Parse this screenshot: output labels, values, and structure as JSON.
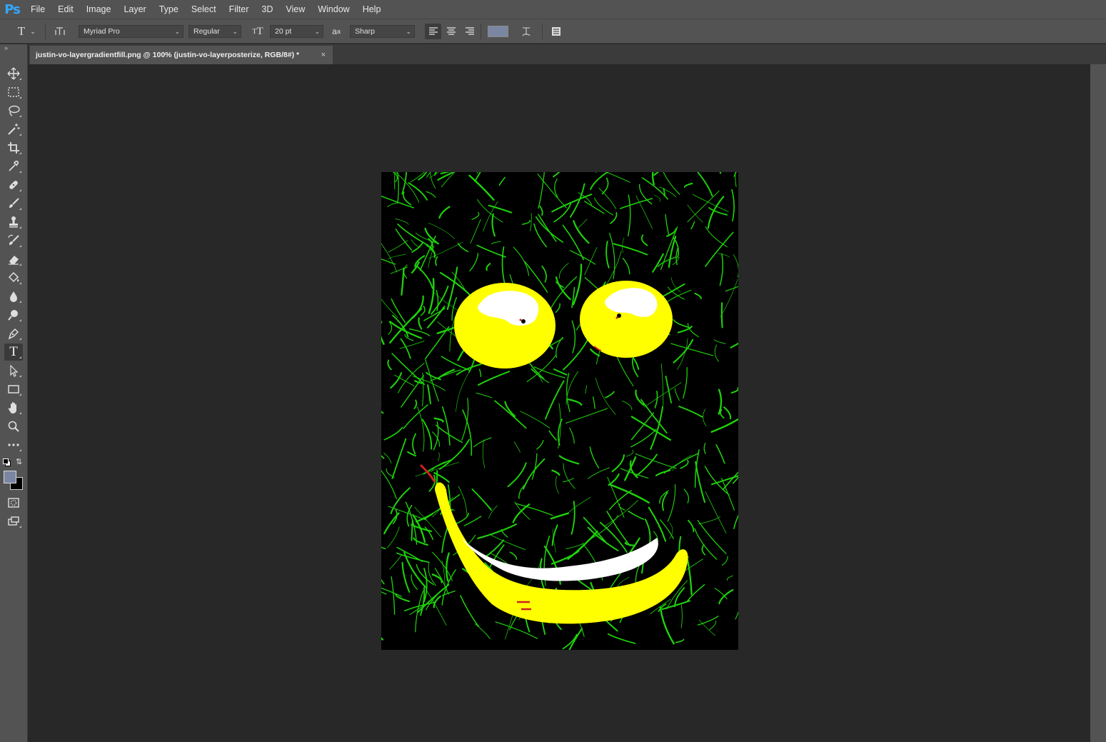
{
  "app": {
    "logo": "Ps"
  },
  "menu": [
    "File",
    "Edit",
    "Image",
    "Layer",
    "Type",
    "Select",
    "Filter",
    "3D",
    "View",
    "Window",
    "Help"
  ],
  "options": {
    "font_family": "Myriad Pro",
    "font_style": "Regular",
    "font_size": "20 pt",
    "antialias_icon_text": "a",
    "antialias": "Sharp",
    "text_color": "#7b86a3"
  },
  "tabs": [
    {
      "title": "justin-vo-layergradientfill.png @ 100% (justin-vo-layerposterize, RGB/8#) *",
      "close": "×"
    }
  ],
  "toolbar": {
    "tools": [
      "move-icon",
      "marquee-icon",
      "lasso-icon",
      "magic-wand-icon",
      "crop-icon",
      "eyedropper-icon",
      "healing-brush-icon",
      "brush-icon",
      "clone-stamp-icon",
      "history-brush-icon",
      "eraser-icon",
      "paint-bucket-icon",
      "blur-icon",
      "dodge-icon",
      "pen-icon",
      "type-icon",
      "path-selection-icon",
      "rectangle-icon",
      "hand-icon",
      "zoom-icon",
      "more-tools-icon"
    ],
    "active_tool": "type-icon",
    "foreground_color": "#7b86a3",
    "background_color": "#000000"
  },
  "colors": {
    "grass": "#1ed20a",
    "fruit": "#ffff00",
    "highlight": "#ffffff",
    "accent": "#cc2200"
  }
}
